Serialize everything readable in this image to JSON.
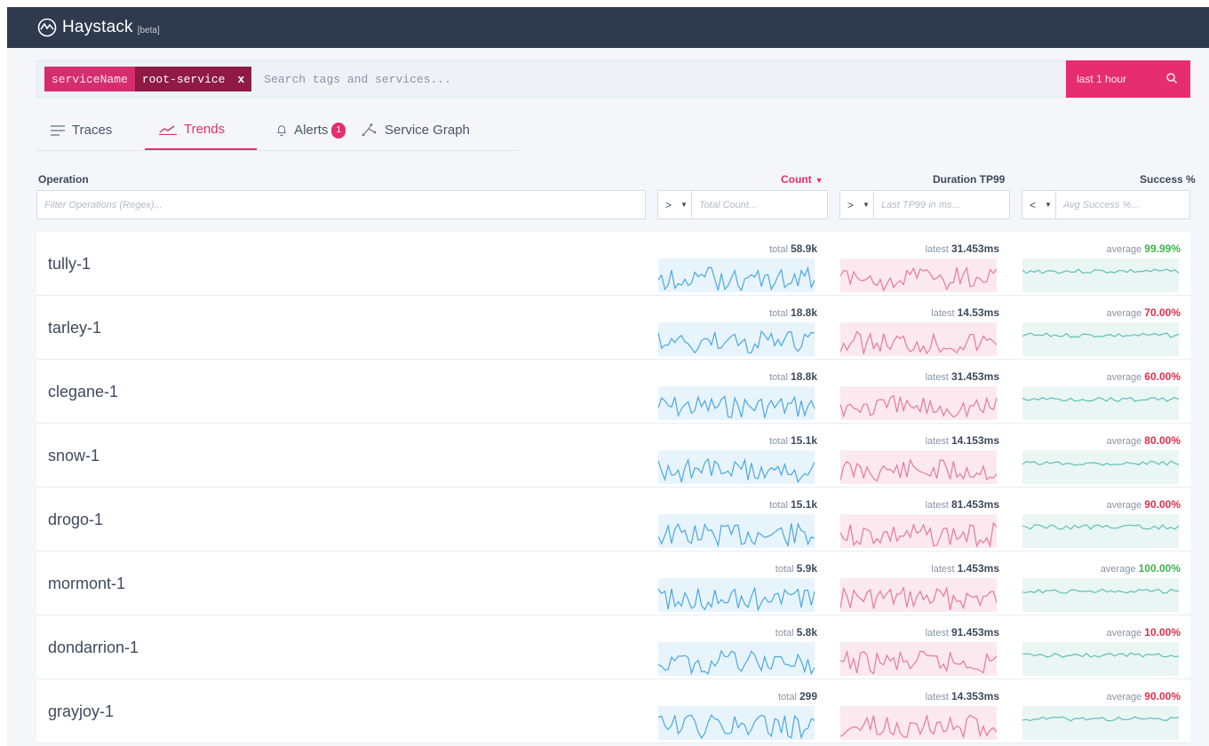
{
  "app": {
    "brand": "Haystack",
    "beta": "[beta]"
  },
  "search": {
    "chip_key": "serviceName",
    "chip_value": "root-service",
    "chip_remove": "x",
    "placeholder": "Search tags and services...",
    "time_range": "last 1 hour"
  },
  "tabs": [
    {
      "label": "Traces"
    },
    {
      "label": "Trends"
    },
    {
      "label": "Alerts",
      "badge": "1"
    },
    {
      "label": "Service Graph"
    }
  ],
  "columns": {
    "operation": "Operation",
    "count": "Count",
    "duration": "Duration TP99",
    "success": "Success %"
  },
  "filters": {
    "operation_placeholder": "Filter Operations (Regex)...",
    "count_cmp": ">",
    "count_placeholder": "Total Count...",
    "duration_cmp": ">",
    "duration_placeholder": "Last TP99 in ms...",
    "success_cmp": "<",
    "success_placeholder": "Avg Success %..."
  },
  "rows": [
    {
      "name": "tully-1",
      "count_prefix": "total",
      "count": "58.9k",
      "dur_prefix": "latest",
      "duration": "31.453ms",
      "succ_prefix": "average",
      "success": "99.99%",
      "success_status": "good"
    },
    {
      "name": "tarley-1",
      "count_prefix": "total",
      "count": "18.8k",
      "dur_prefix": "latest",
      "duration": "14.53ms",
      "succ_prefix": "average",
      "success": "70.00%",
      "success_status": "bad"
    },
    {
      "name": "clegane-1",
      "count_prefix": "total",
      "count": "18.8k",
      "dur_prefix": "latest",
      "duration": "31.453ms",
      "succ_prefix": "average",
      "success": "60.00%",
      "success_status": "bad"
    },
    {
      "name": "snow-1",
      "count_prefix": "total",
      "count": "15.1k",
      "dur_prefix": "latest",
      "duration": "14.153ms",
      "succ_prefix": "average",
      "success": "80.00%",
      "success_status": "bad"
    },
    {
      "name": "drogo-1",
      "count_prefix": "total",
      "count": "15.1k",
      "dur_prefix": "latest",
      "duration": "81.453ms",
      "succ_prefix": "average",
      "success": "90.00%",
      "success_status": "bad"
    },
    {
      "name": "mormont-1",
      "count_prefix": "total",
      "count": "5.9k",
      "dur_prefix": "latest",
      "duration": "1.453ms",
      "succ_prefix": "average",
      "success": "100.00%",
      "success_status": "good"
    },
    {
      "name": "dondarrion-1",
      "count_prefix": "total",
      "count": "5.8k",
      "dur_prefix": "latest",
      "duration": "91.453ms",
      "succ_prefix": "average",
      "success": "10.00%",
      "success_status": "bad"
    },
    {
      "name": "grayjoy-1",
      "count_prefix": "total",
      "count": "299",
      "dur_prefix": "latest",
      "duration": "14.353ms",
      "succ_prefix": "average",
      "success": "90.00%",
      "success_status": "bad"
    }
  ],
  "colors": {
    "accent": "#e52d6f",
    "count_line": "#4aa8e0",
    "duration_line": "#e8789c",
    "success_line": "#5cc2b4",
    "good": "#3cb54a",
    "bad": "#e52d4a"
  }
}
